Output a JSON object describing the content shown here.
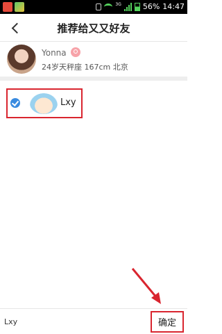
{
  "status_bar": {
    "battery": "56%",
    "time": "14:47",
    "network": "3G",
    "icons": [
      "app-icon-1",
      "app-icon-2",
      "mute-icon",
      "wifi-icon",
      "signal-icon",
      "battery-icon"
    ]
  },
  "header": {
    "title": "推荐给又又好友",
    "back_icon": "chevron-left-icon"
  },
  "profile": {
    "name": "Yonna",
    "info": "24岁天秤座 167cm 北京",
    "gender_icon": "female-icon"
  },
  "friends": [
    {
      "name": "Lxy",
      "checked": true
    }
  ],
  "footer": {
    "selected": "Lxy",
    "confirm_label": "确定"
  },
  "colors": {
    "highlight_red": "#d9252f",
    "check_blue": "#3a8be0",
    "status_green": "#55d35d"
  }
}
